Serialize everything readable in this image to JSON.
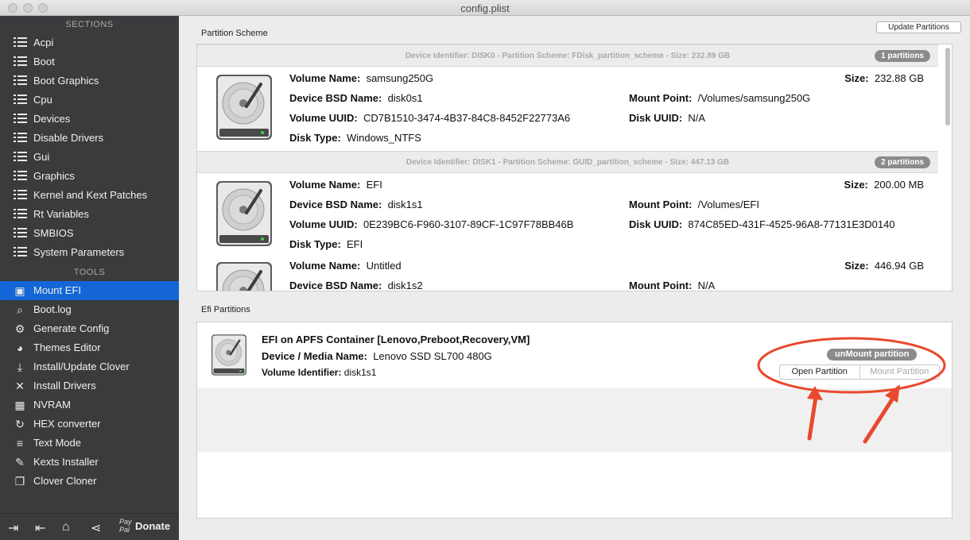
{
  "window": {
    "title": "config.plist"
  },
  "sidebar": {
    "sections_header": "SECTIONS",
    "tools_header": "TOOLS",
    "sections": [
      {
        "label": "Acpi"
      },
      {
        "label": "Boot"
      },
      {
        "label": "Boot Graphics"
      },
      {
        "label": "Cpu"
      },
      {
        "label": "Devices"
      },
      {
        "label": "Disable Drivers"
      },
      {
        "label": "Gui"
      },
      {
        "label": "Graphics"
      },
      {
        "label": "Kernel and Kext Patches"
      },
      {
        "label": "Rt Variables"
      },
      {
        "label": "SMBIOS"
      },
      {
        "label": "System Parameters"
      }
    ],
    "tools": [
      {
        "label": "Mount EFI",
        "icon": "mount-efi-icon",
        "active": true
      },
      {
        "label": "Boot.log",
        "icon": "log-search-icon"
      },
      {
        "label": "Generate Config",
        "icon": "gears-icon"
      },
      {
        "label": "Themes Editor",
        "icon": "palette-icon"
      },
      {
        "label": "Install/Update Clover",
        "icon": "download-icon"
      },
      {
        "label": "Install Drivers",
        "icon": "tools-icon"
      },
      {
        "label": "NVRAM",
        "icon": "chip-icon"
      },
      {
        "label": "HEX converter",
        "icon": "refresh-icon"
      },
      {
        "label": "Text Mode",
        "icon": "text-lines-icon"
      },
      {
        "label": "Kexts Installer",
        "icon": "kext-icon"
      },
      {
        "label": "Clover Cloner",
        "icon": "clone-icon"
      }
    ],
    "bottom": {
      "paypal_line1": "Pay",
      "paypal_line2": "Pal",
      "donate": "Donate"
    }
  },
  "partition_scheme": {
    "label": "Partition Scheme",
    "update_button": "Update Partitions",
    "disks": [
      {
        "header": "Device Identifier: DISK0 - Partition Scheme: FDisk_partition_scheme - Size: 232.89 GB",
        "badge": "1 partitions",
        "partitions": [
          {
            "volume_name_label": "Volume Name:",
            "volume_name": "samsung250G",
            "bsd_label": "Device BSD Name:",
            "bsd": "disk0s1",
            "uuid_label": "Volume UUID:",
            "uuid": "CD7B1510-3474-4B37-84C8-8452F22773A6",
            "type_label": "Disk Type:",
            "type": "Windows_NTFS",
            "size_label": "Size:",
            "size": "232.88 GB",
            "mount_label": "Mount Point:",
            "mount": "/Volumes/samsung250G",
            "disk_uuid_label": "Disk UUID:",
            "disk_uuid": "N/A"
          }
        ]
      },
      {
        "header": "Device Identifier: DISK1 - Partition Scheme: GUID_partition_scheme - Size: 447.13 GB",
        "badge": "2 partitions",
        "partitions": [
          {
            "volume_name_label": "Volume Name:",
            "volume_name": "EFI",
            "bsd_label": "Device BSD Name:",
            "bsd": "disk1s1",
            "uuid_label": "Volume UUID:",
            "uuid": "0E239BC6-F960-3107-89CF-1C97F78BB46B",
            "type_label": "Disk Type:",
            "type": "EFI",
            "size_label": "Size:",
            "size": "200.00 MB",
            "mount_label": "Mount Point:",
            "mount": "/Volumes/EFI",
            "disk_uuid_label": "Disk UUID:",
            "disk_uuid": "874C85ED-431F-4525-96A8-77131E3D0140"
          },
          {
            "volume_name_label": "Volume Name:",
            "volume_name": "Untitled",
            "bsd_label": "Device BSD Name:",
            "bsd": "disk1s2",
            "size_label": "Size:",
            "size": "446.94 GB",
            "mount_label": "Mount Point:",
            "mount": "N/A"
          }
        ]
      }
    ]
  },
  "efi_partitions": {
    "label": "Efi Partitions",
    "entry": {
      "title": "EFI on APFS Container [Lenovo,Preboot,Recovery,VM]",
      "media_label": "Device / Media Name:",
      "media": "Lenovo SSD SL700 480G",
      "volume_label": "Volume Identifier:",
      "volume": "disk1s1"
    },
    "unmount_button": "unMount partition",
    "open_button": "Open Partition",
    "mount_button": "Mount Partition"
  },
  "colors": {
    "sidebar_bg": "#3a3b3d",
    "active": "#1466d6",
    "annotation": "#e8492e"
  }
}
